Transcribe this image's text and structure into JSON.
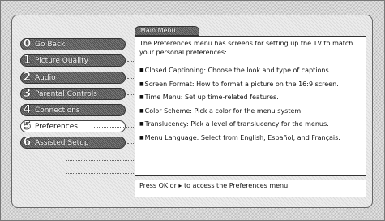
{
  "menu": [
    {
      "num": "0",
      "label": "Go Back",
      "selected": false
    },
    {
      "num": "1",
      "label": "Picture Quality",
      "selected": false
    },
    {
      "num": "2",
      "label": "Audio",
      "selected": false
    },
    {
      "num": "3",
      "label": "Parental Controls",
      "selected": false
    },
    {
      "num": "4",
      "label": "Connections",
      "selected": false
    },
    {
      "num": "5",
      "label": "Preferences",
      "selected": true
    },
    {
      "num": "6",
      "label": "Assisted Setup",
      "selected": false
    }
  ],
  "panel": {
    "tab_title": "Main Menu",
    "intro": "The Preferences menu has screens for setting up the TV to match your personal preferences:",
    "bullet_glyph": "■",
    "items": [
      "Closed Captioning: Choose the look and type of captions.",
      "Screen Format: How to format a picture on the 16:9 screen.",
      "Time Menu: Set up time-related features.",
      "Color Scheme: Pick a color for the menu system.",
      "Translucency: Pick a level of translucency for the menus.",
      "Menu Language: Select from English, Español, and Français."
    ]
  },
  "hint": {
    "prefix": "Press OK or",
    "arrow": "▸",
    "suffix": "to access the Preferences menu."
  }
}
